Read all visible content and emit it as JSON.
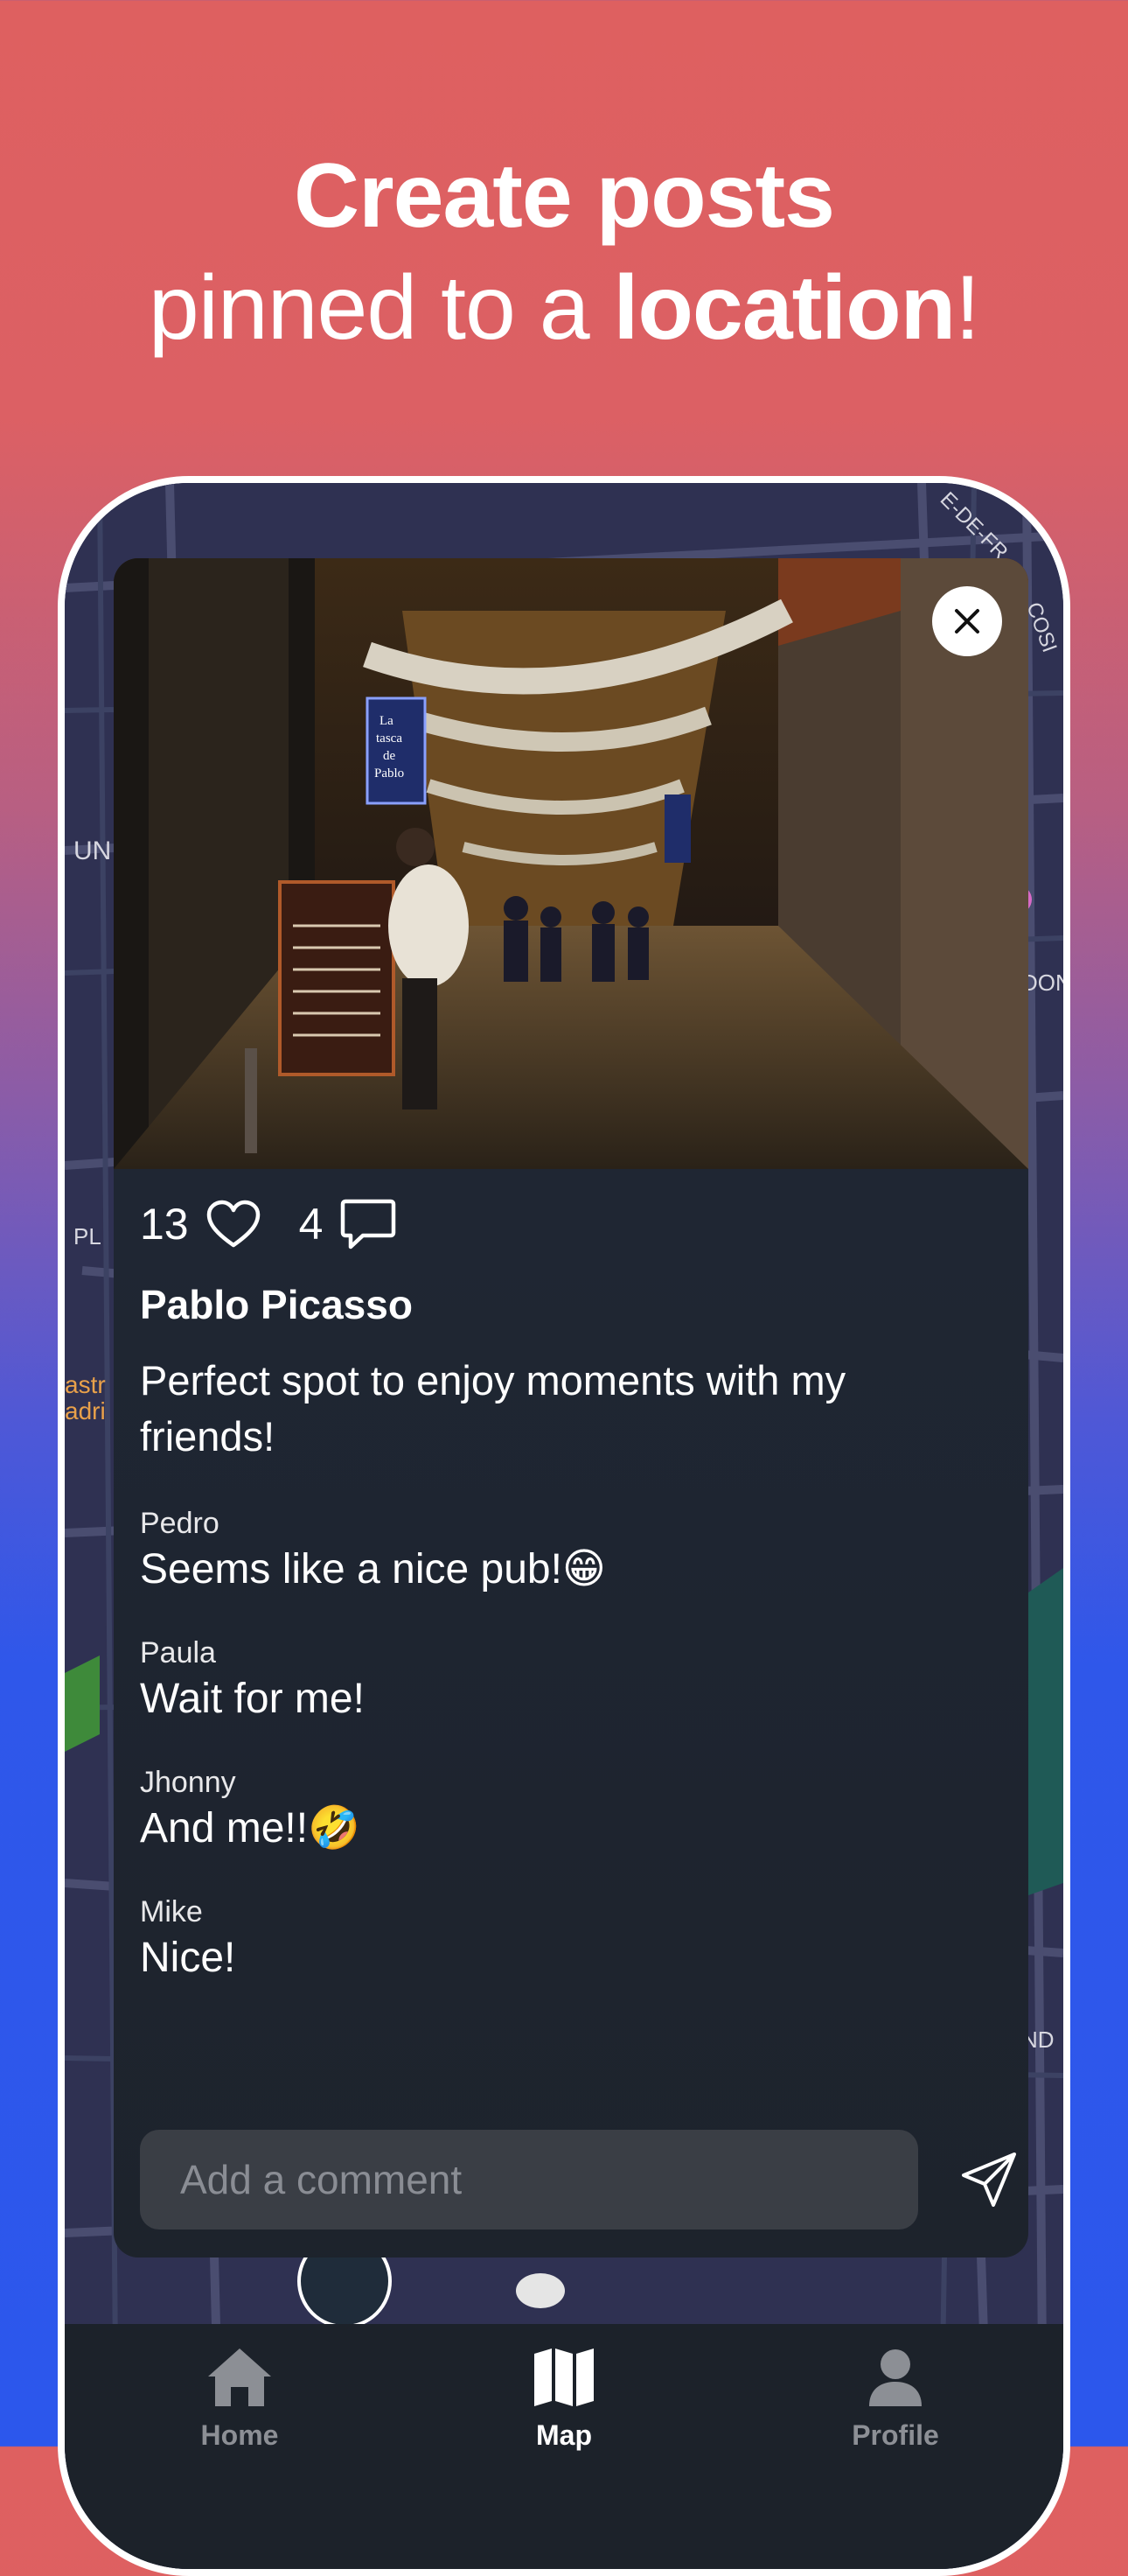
{
  "headline": {
    "line1": "Create posts",
    "line2_prefix": "pinned to a ",
    "line2_bold": "location",
    "line2_suffix": "!"
  },
  "map": {
    "labels": [
      "UN",
      "PL",
      "astr",
      "adri",
      "DON",
      "ND",
      "E-DE-FR",
      "COSI"
    ]
  },
  "post": {
    "likes": "13",
    "comments_count": "4",
    "author": "Pablo Picasso",
    "caption": "Perfect spot to enjoy moments with my friends!",
    "photo_sign": [
      "La",
      "tasca",
      "de",
      "Pablo"
    ],
    "comments": [
      {
        "name": "Pedro",
        "text": "Seems like a nice pub!😁"
      },
      {
        "name": "Paula",
        "text": "Wait for me!"
      },
      {
        "name": "Jhonny",
        "text": "And me!!🤣"
      },
      {
        "name": "Mike",
        "text": "Nice!"
      }
    ],
    "comment_placeholder": "Add a comment"
  },
  "icons": {
    "close": "close-icon",
    "like": "heart-icon",
    "comment": "speech-bubble-icon",
    "send": "paper-plane-icon",
    "home": "home-icon",
    "map": "map-icon",
    "profile": "person-icon"
  },
  "tabbar": {
    "tabs": [
      {
        "label": "Home",
        "active": false
      },
      {
        "label": "Map",
        "active": true
      },
      {
        "label": "Profile",
        "active": false
      }
    ]
  },
  "colors": {
    "gradient_top": "#de6060",
    "gradient_bottom": "#2c57ec",
    "card_bg": "#1f2733",
    "tabbar_bg": "#1c222a",
    "active_tab": "#ffffff",
    "inactive_tab": "#8c8f95"
  }
}
